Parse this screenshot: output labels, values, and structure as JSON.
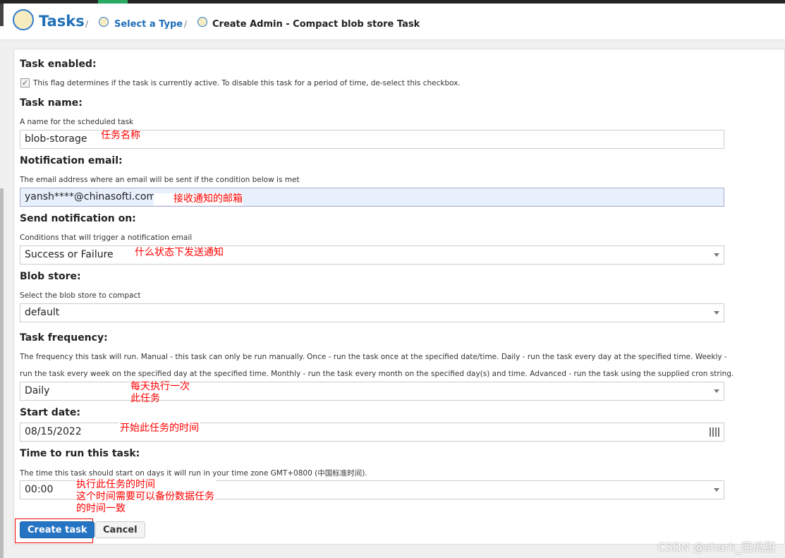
{
  "header": {
    "title": "Tasks",
    "breadcrumbs": [
      "Select a Type",
      "Create Admin - Compact blob store Task"
    ]
  },
  "form": {
    "enabled": {
      "label": "Task enabled:",
      "checked": true,
      "desc": "This flag determines if the task is currently active. To disable this task for a period of time, de-select this checkbox."
    },
    "name": {
      "label": "Task name:",
      "desc": "A name for the scheduled task",
      "value": "blob-storage",
      "note": "任务名称"
    },
    "email": {
      "label": "Notification email:",
      "desc": "The email address where an email will be sent if the condition below is met",
      "value": "yansh****@chinasofti.com",
      "note": "接收通知的邮箱"
    },
    "notify": {
      "label": "Send notification on:",
      "desc": "Conditions that will trigger a notification email",
      "value": "Success or Failure",
      "note": "什么状态下发送通知"
    },
    "blob": {
      "label": "Blob store:",
      "desc": "Select the blob store to compact",
      "value": "default"
    },
    "frequency": {
      "label": "Task frequency:",
      "desc1": "The frequency this task will run. Manual - this task can only be run manually. Once - run the task once at the specified date/time. Daily - run the task every day at the specified time. Weekly -",
      "desc2": "run the task every week on the specified day at the specified time. Monthly - run the task every month on the specified day(s) and time. Advanced - run the task using the supplied cron string.",
      "value": "Daily",
      "note": "每天执行一次\n此任务"
    },
    "start": {
      "label": "Start date:",
      "value": "08/15/2022",
      "note": "开始此任务的时间"
    },
    "time": {
      "label": "Time to run this task:",
      "desc": "The time this task should start on days it will run in your time zone GMT+0800 (中国标准时间).",
      "value": "00:00",
      "note": "执行此任务的时间\n这个时间需要可以备份数据任务\n的时间一致"
    },
    "create_label": "Create task",
    "cancel_label": "Cancel"
  },
  "watermark": "CSDN @shark_西瓜甜",
  "colors": {
    "accent": "#2574c4",
    "annotation": "#ff0000"
  }
}
